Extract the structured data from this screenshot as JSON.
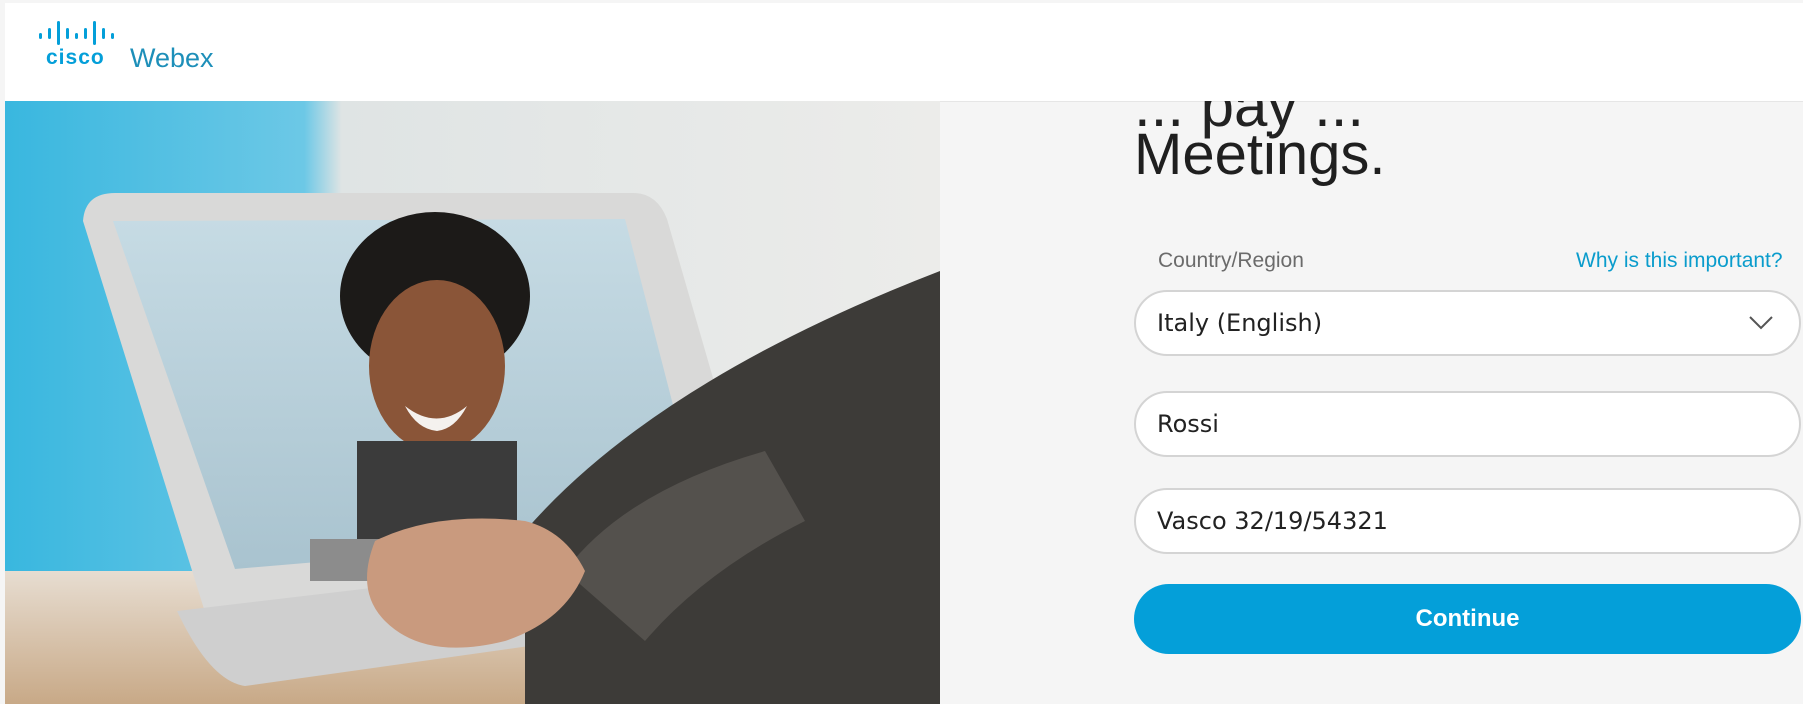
{
  "brand": {
    "logo_mark": "cisco",
    "product_name": "Webex",
    "colors": {
      "primary": "#049fd9",
      "link": "#0a9ccc"
    }
  },
  "hero": {
    "image_desc": "photo-of-person-on-video-call-laptop"
  },
  "form": {
    "heading_partial": "... pay ...",
    "heading": "Meetings.",
    "country": {
      "label": "Country/Region",
      "help_link": "Why is this important?",
      "value": "Italy (English)"
    },
    "last_name": {
      "value": "Rossi"
    },
    "tax_code": {
      "value": "Vasco 32/19/54321"
    },
    "continue_label": "Continue"
  }
}
